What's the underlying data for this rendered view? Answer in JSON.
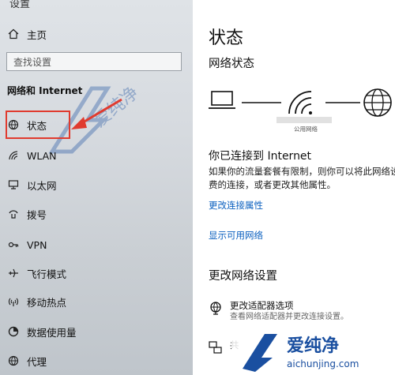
{
  "sidebar": {
    "top_partial": "设置",
    "home_label": "主页",
    "search_placeholder": "查找设置",
    "section_title": "网络和 Internet",
    "items": [
      {
        "label": "状态",
        "icon": "globe-icon"
      },
      {
        "label": "WLAN",
        "icon": "wifi-icon"
      },
      {
        "label": "以太网",
        "icon": "ethernet-icon"
      },
      {
        "label": "拨号",
        "icon": "dialup-icon"
      },
      {
        "label": "VPN",
        "icon": "vpn-icon"
      },
      {
        "label": "飞行模式",
        "icon": "airplane-icon"
      },
      {
        "label": "移动热点",
        "icon": "hotspot-icon"
      },
      {
        "label": "数据使用量",
        "icon": "data-usage-icon"
      },
      {
        "label": "代理",
        "icon": "globe-icon"
      }
    ]
  },
  "main": {
    "title": "状态",
    "network_status_heading": "网络状态",
    "network_name": "公用网络",
    "connected_text": "你已连接到 Internet",
    "description_line1": "如果你的流量套餐有限制，则你可以将此网络设",
    "description_line2": "费的连接，或者更改其他属性。",
    "link_change_properties": "更改连接属性",
    "link_show_networks": "显示可用网络",
    "change_settings_heading": "更改网络设置",
    "adapter_option_title": "更改适配器选项",
    "adapter_option_desc": "查看网络适配器并更改连接设置。",
    "sharing_option_title": "共"
  },
  "watermark": {
    "brand": "爱纯净",
    "url": "aichunjing.com"
  },
  "colors": {
    "link": "#0a5fbf",
    "highlight": "#e03b2f",
    "watermark": "#1a4fa0"
  }
}
